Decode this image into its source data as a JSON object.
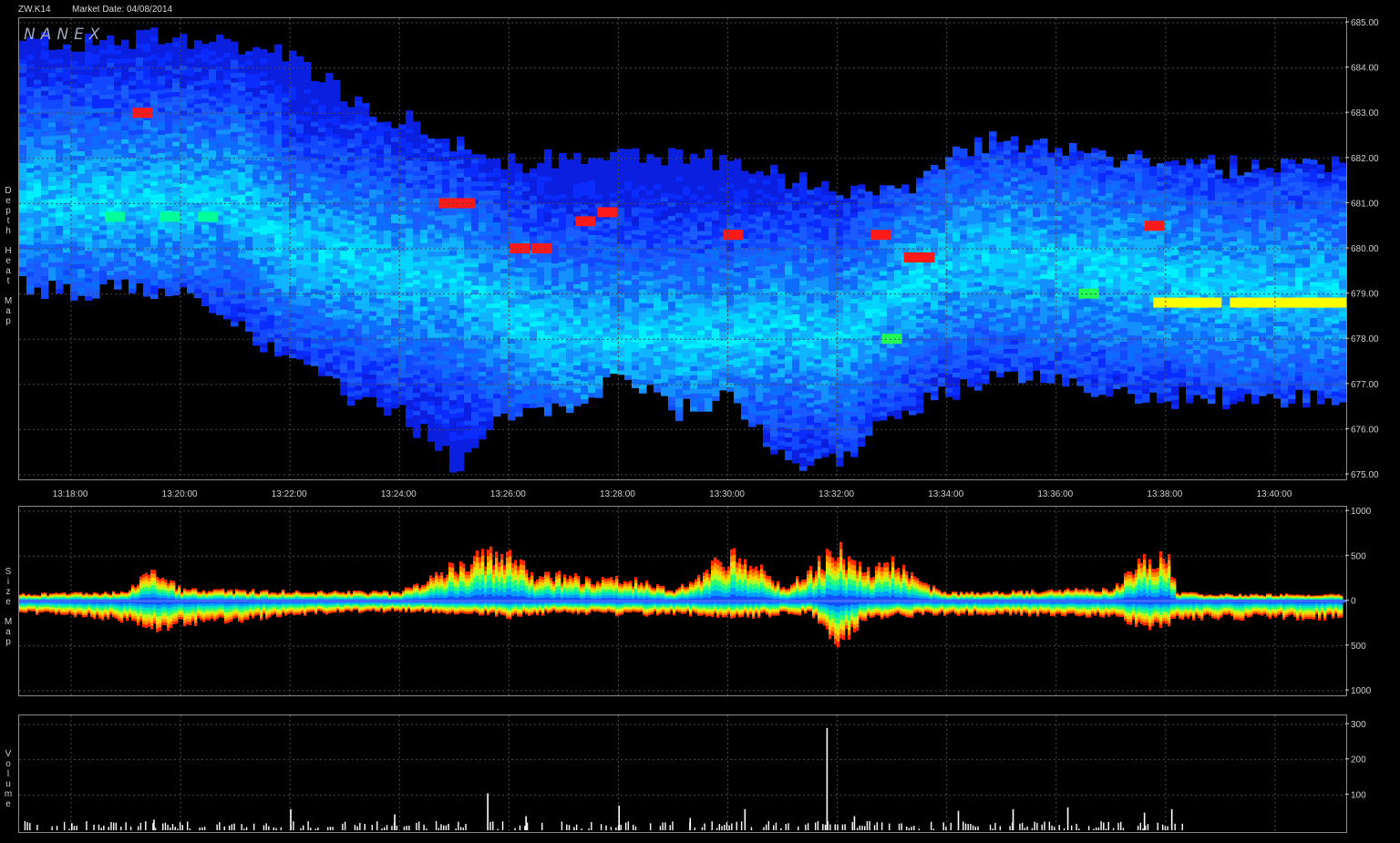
{
  "header": {
    "symbol": "ZW.K14",
    "market_date": "Market Date: 04/08/2014"
  },
  "logo": "NANEX",
  "panel_labels": {
    "heat": "Depth Heat Map",
    "size": "Size Map",
    "volume": "Volume"
  },
  "colors": {
    "background": "#000000",
    "grid": "#4a4a4a",
    "frame": "#8a8a8a",
    "low": "#0a2cff",
    "mid": "#00e5ff",
    "high": "#ffff00",
    "max": "#ff1a1a"
  },
  "chart_data": [
    {
      "type": "heatmap",
      "title": "Depth Heat Map",
      "x_ticks": [
        "13:18:00",
        "13:20:00",
        "13:22:00",
        "13:24:00",
        "13:26:00",
        "13:28:00",
        "13:30:00",
        "13:32:00",
        "13:34:00",
        "13:36:00",
        "13:38:00",
        "13:40:00"
      ],
      "x_range_minutes": [
        17.05,
        41.3
      ],
      "y_ticks": [
        "685.00",
        "684.00",
        "683.00",
        "682.00",
        "681.00",
        "680.00",
        "679.00",
        "678.00",
        "677.00",
        "676.00",
        "675.00"
      ],
      "ylim": [
        675,
        685
      ],
      "book_band": {
        "time_min": [
          17.0,
          18,
          19,
          20,
          21,
          22,
          23,
          24,
          25,
          26,
          27,
          28,
          29,
          30,
          31,
          32,
          33,
          34,
          35,
          36,
          37,
          38,
          39,
          40,
          41
        ],
        "upper": [
          684.5,
          684.5,
          684.6,
          684.6,
          684.5,
          684.2,
          683.3,
          682.8,
          682.3,
          681.8,
          682.0,
          682.0,
          682.0,
          681.8,
          681.5,
          681.3,
          681.2,
          682.0,
          682.4,
          682.2,
          682.0,
          681.9,
          681.8,
          681.8,
          681.8
        ],
        "lower": [
          679.2,
          679.0,
          679.2,
          679.0,
          678.2,
          677.4,
          676.8,
          676.3,
          675.2,
          676.4,
          676.6,
          677.1,
          676.4,
          676.8,
          675.3,
          675.3,
          676.3,
          676.8,
          677.2,
          677.0,
          676.7,
          676.7,
          676.7,
          676.7,
          676.7
        ],
        "bright_level": [
          681.0,
          681.0,
          681.0,
          681.0,
          681.0,
          680.0,
          679.7,
          679.4,
          679.2,
          678.5,
          678.0,
          678.0,
          678.0,
          678.0,
          678.3,
          678.0,
          679.0,
          679.6,
          679.8,
          679.5,
          679.5,
          679.3,
          679.0,
          679.0,
          679.0
        ]
      },
      "hot_spots": [
        {
          "t": 19.3,
          "price": 683.0,
          "color": "#ff1a1a"
        },
        {
          "t": 24.9,
          "price": 681.0,
          "color": "#ff1a1a"
        },
        {
          "t": 25.2,
          "price": 681.0,
          "color": "#ff1a1a"
        },
        {
          "t": 26.2,
          "price": 680.0,
          "color": "#ff1a1a"
        },
        {
          "t": 26.6,
          "price": 680.0,
          "color": "#ff1a1a"
        },
        {
          "t": 27.8,
          "price": 680.8,
          "color": "#ff1a1a"
        },
        {
          "t": 27.4,
          "price": 680.6,
          "color": "#ff1a1a"
        },
        {
          "t": 30.1,
          "price": 680.3,
          "color": "#ff1a1a"
        },
        {
          "t": 32.8,
          "price": 680.3,
          "color": "#ff1a1a"
        },
        {
          "t": 33.4,
          "price": 679.8,
          "color": "#ff1a1a"
        },
        {
          "t": 33.6,
          "price": 679.8,
          "color": "#ff1a1a"
        },
        {
          "t": 37.8,
          "price": 680.5,
          "color": "#ff1a1a"
        },
        {
          "t": 38.4,
          "price": 678.8,
          "color": "#ffff00"
        },
        {
          "t": 39.8,
          "price": 678.8,
          "color": "#ffff00"
        },
        {
          "t": 41.0,
          "price": 678.8,
          "color": "#ffff00"
        },
        {
          "t": 18.8,
          "price": 680.7,
          "color": "#00ff99"
        },
        {
          "t": 19.8,
          "price": 680.7,
          "color": "#00ff99"
        },
        {
          "t": 20.5,
          "price": 680.7,
          "color": "#00ff99"
        },
        {
          "t": 33.0,
          "price": 678.0,
          "color": "#22ff55"
        },
        {
          "t": 36.6,
          "price": 679.0,
          "color": "#22ff55"
        }
      ]
    },
    {
      "type": "area",
      "title": "Size Map",
      "y_ticks": [
        "1000",
        "500",
        "0",
        "500",
        "1000"
      ],
      "ylim": [
        -1000,
        1000
      ],
      "time_min": [
        17.0,
        18,
        19,
        19.5,
        20,
        21,
        22,
        23,
        24,
        25,
        25.5,
        26,
        26.5,
        27,
        27.5,
        28,
        28.5,
        29,
        30,
        30.5,
        31,
        31.5,
        32,
        32.5,
        33,
        33.5,
        34,
        35,
        36,
        37,
        37.5,
        38,
        38.2,
        39,
        40,
        41
      ],
      "bid_size": [
        60,
        80,
        90,
        380,
        120,
        110,
        100,
        90,
        90,
        420,
        560,
        520,
        280,
        300,
        220,
        260,
        200,
        100,
        550,
        420,
        120,
        380,
        620,
        320,
        450,
        200,
        80,
        90,
        120,
        120,
        450,
        560,
        80,
        60,
        60,
        60
      ],
      "ask_size": [
        -120,
        -160,
        -220,
        -330,
        -260,
        -220,
        -150,
        -120,
        -110,
        -130,
        -140,
        -180,
        -150,
        -120,
        -140,
        -150,
        -150,
        -140,
        -180,
        -170,
        -150,
        -140,
        -520,
        -190,
        -170,
        -160,
        -150,
        -140,
        -160,
        -170,
        -280,
        -300,
        -190,
        -190,
        -190,
        -190
      ]
    },
    {
      "type": "bar",
      "title": "Volume",
      "y_ticks": [
        "300",
        "200",
        "100"
      ],
      "ylim": [
        0,
        300
      ],
      "spikes": [
        {
          "t": 18.0,
          "v": 20
        },
        {
          "t": 19.5,
          "v": 30
        },
        {
          "t": 22.0,
          "v": 60
        },
        {
          "t": 23.9,
          "v": 45
        },
        {
          "t": 25.6,
          "v": 105
        },
        {
          "t": 26.3,
          "v": 40
        },
        {
          "t": 28.0,
          "v": 70
        },
        {
          "t": 29.3,
          "v": 35
        },
        {
          "t": 30.3,
          "v": 60
        },
        {
          "t": 31.8,
          "v": 290
        },
        {
          "t": 32.3,
          "v": 40
        },
        {
          "t": 34.2,
          "v": 55
        },
        {
          "t": 35.2,
          "v": 60
        },
        {
          "t": 36.2,
          "v": 65
        },
        {
          "t": 37.6,
          "v": 50
        },
        {
          "t": 38.1,
          "v": 60
        }
      ],
      "trading_end_min": 38.4
    }
  ]
}
